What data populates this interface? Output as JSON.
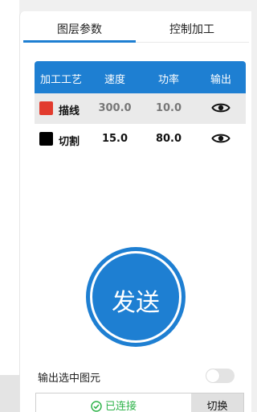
{
  "tabs": [
    {
      "label": "图层参数",
      "active": true
    },
    {
      "label": "控制加工",
      "active": false
    }
  ],
  "table": {
    "headers": [
      "加工工艺",
      "速度",
      "功率",
      "输出"
    ],
    "rows": [
      {
        "color": "#e23b2e",
        "name": "描线",
        "speed": "300.0",
        "power": "10.0",
        "output_icon": "eye-icon",
        "selected": true
      },
      {
        "color": "#000000",
        "name": "切割",
        "speed": "15.0",
        "power": "80.0",
        "output_icon": "eye-icon",
        "selected": false
      }
    ]
  },
  "send_button": {
    "label": "发送"
  },
  "output_selected": {
    "label": "输出选中图元",
    "enabled": false
  },
  "connection": {
    "status": "已连接",
    "status_icon": "check-circle-icon",
    "switch_label": "切换"
  },
  "colors": {
    "accent": "#1e7fd2",
    "connected": "#2fb34a"
  }
}
